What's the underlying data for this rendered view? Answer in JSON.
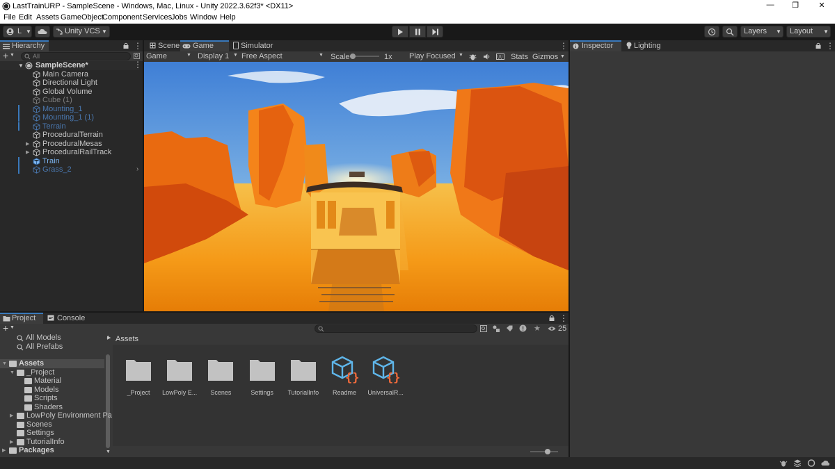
{
  "window": {
    "title": "LastTrainURP - SampleScene - Windows, Mac, Linux - Unity 2022.3.62f3* <DX11>",
    "minimize": "—",
    "maximize": "❐",
    "close": "✕"
  },
  "menu": [
    "File",
    "Edit",
    "Assets",
    "GameObject",
    "Component",
    "Services",
    "Jobs",
    "Window",
    "Help"
  ],
  "toolbar": {
    "account": "L",
    "vcs": "Unity VCS",
    "layers": "Layers",
    "layout": "Layout",
    "play_icon": "play-icon",
    "pause_icon": "pause-icon",
    "step_icon": "step-icon"
  },
  "hierarchy": {
    "tab": "Hierarchy",
    "search_placeholder": "All",
    "scene": "SampleScene*",
    "items": [
      {
        "label": "Main Camera",
        "state": "normal"
      },
      {
        "label": "Directional Light",
        "state": "normal"
      },
      {
        "label": "Global Volume",
        "state": "normal"
      },
      {
        "label": "Cube (1)",
        "state": "inactive"
      },
      {
        "label": "Mounting_1",
        "state": "inactive-selected"
      },
      {
        "label": "Mounting_1 (1)",
        "state": "inactive-selected"
      },
      {
        "label": "Terrain",
        "state": "inactive-selected"
      },
      {
        "label": "ProceduralTerrain",
        "state": "normal"
      },
      {
        "label": "ProceduralMesas",
        "state": "expandable"
      },
      {
        "label": "ProceduralRailTrack",
        "state": "expandable"
      },
      {
        "label": "Train",
        "state": "prefab-selected"
      },
      {
        "label": "Grass_2",
        "state": "inactive-selected"
      }
    ]
  },
  "game_view": {
    "tabs": [
      "Scene",
      "Game",
      "Simulator"
    ],
    "active_tab": "Game",
    "mode": "Game",
    "display": "Display 1",
    "aspect": "Free Aspect",
    "scale_label": "Scale",
    "scale_value": "1x",
    "play_focus": "Play Focused",
    "stats": "Stats",
    "gizmos": "Gizmos",
    "scale_fraction": 0.0
  },
  "inspector": {
    "tabs": [
      "Inspector",
      "Lighting"
    ]
  },
  "project": {
    "tabs": [
      "Project",
      "Console"
    ],
    "favorites": [
      "All Models",
      "All Prefabs"
    ],
    "tree": [
      {
        "label": "Assets",
        "level": 0,
        "bold": true
      },
      {
        "label": "_Project",
        "level": 1
      },
      {
        "label": "Material",
        "level": 2
      },
      {
        "label": "Models",
        "level": 2
      },
      {
        "label": "Scripts",
        "level": 2
      },
      {
        "label": "Shaders",
        "level": 2
      },
      {
        "label": "LowPoly Environment Pa",
        "level": 1
      },
      {
        "label": "Scenes",
        "level": 1
      },
      {
        "label": "Settings",
        "level": 1
      },
      {
        "label": "TutorialInfo",
        "level": 1
      },
      {
        "label": "Packages",
        "level": 0,
        "bold": true
      }
    ],
    "breadcrumb": "Assets",
    "hidden_count": "25",
    "assets": [
      {
        "label": "_Project",
        "kind": "folder"
      },
      {
        "label": "LowPoly E...",
        "kind": "folder"
      },
      {
        "label": "Scenes",
        "kind": "folder"
      },
      {
        "label": "Settings",
        "kind": "folder"
      },
      {
        "label": "TutorialInfo",
        "kind": "folder"
      },
      {
        "label": "Readme",
        "kind": "scriptable"
      },
      {
        "label": "UniversalR...",
        "kind": "scriptable"
      }
    ]
  }
}
